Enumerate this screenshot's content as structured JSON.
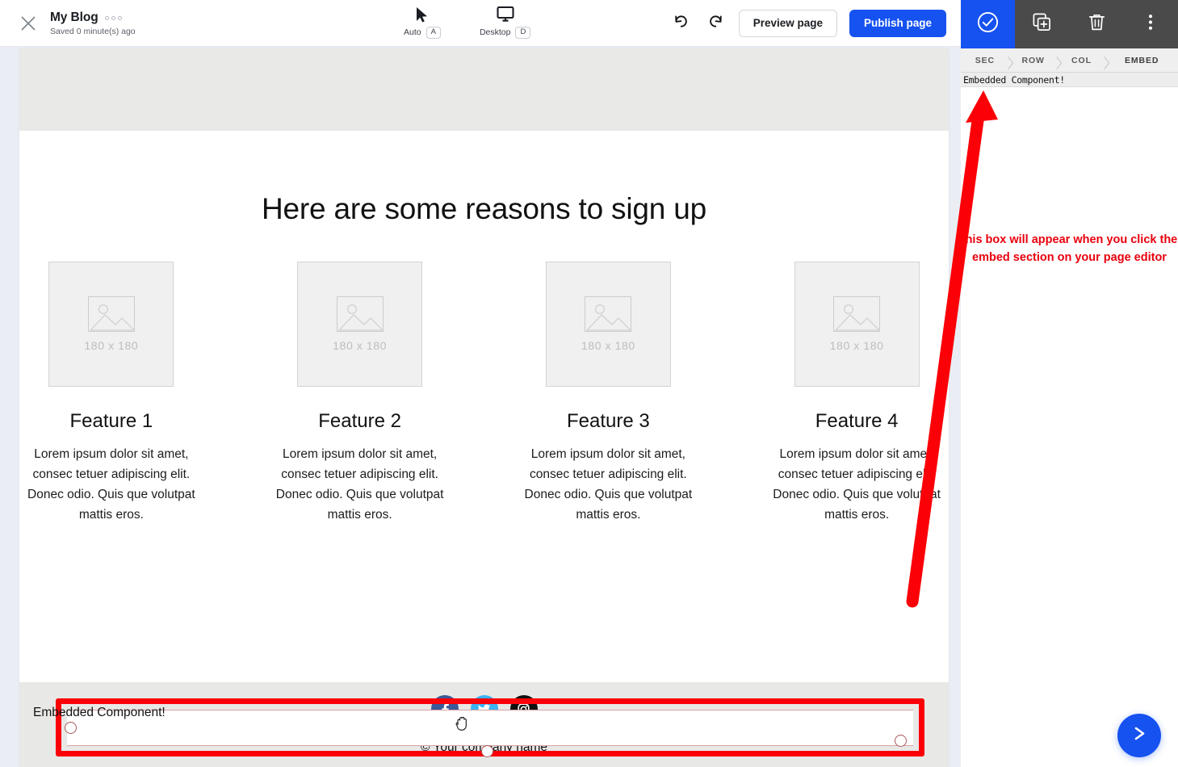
{
  "toolbar": {
    "close_icon": "close-x-icon",
    "page_title": "My Blog",
    "saved_text": "Saved 0 minute(s) ago",
    "more_dots": "three-dots-icon",
    "viewmodes": [
      {
        "icon": "cursor-arrow-icon",
        "label": "Auto",
        "key": "A"
      },
      {
        "icon": "desktop-monitor-icon",
        "label": "Desktop",
        "key": "D"
      }
    ],
    "undo_icon": "undo-arrow-icon",
    "redo_icon": "redo-arrow-icon",
    "preview_label": "Preview page",
    "publish_label": "Publish page",
    "primary_color": "#1652f0"
  },
  "page": {
    "hero_title": "Here are some reasons to sign up",
    "features": [
      {
        "placeholder": "180 x 180",
        "title": "Feature 1",
        "body": "Lorem ipsum dolor sit amet, consec tetuer adipiscing elit. Donec odio. Quis que volutpat mattis eros."
      },
      {
        "placeholder": "180 x 180",
        "title": "Feature 2",
        "body": "Lorem ipsum dolor sit amet, consec tetuer adipiscing elit. Donec odio. Quis que volutpat mattis eros."
      },
      {
        "placeholder": "180 x 180",
        "title": "Feature 3",
        "body": "Lorem ipsum dolor sit amet, consec tetuer adipiscing elit. Donec odio. Quis que volutpat mattis eros."
      },
      {
        "placeholder": "180 x 180",
        "title": "Feature 4",
        "body": "Lorem ipsum dolor sit amet, consec tetuer adipiscing elit. Donec odio. Quis que volutpat mattis eros."
      }
    ],
    "embed": {
      "label": "Embedded Component!",
      "selection_color": "#fb0007",
      "cursor": "grab-hand-cursor"
    },
    "footer": {
      "socials": [
        {
          "name": "facebook-icon",
          "color": "#3b5998"
        },
        {
          "name": "twitter-icon",
          "color": "#3ab3f2"
        },
        {
          "name": "instagram-icon",
          "color": "#111111"
        }
      ],
      "copyright": "© Your company name"
    }
  },
  "right_panel": {
    "icons": [
      {
        "name": "check-circle-icon",
        "active": true
      },
      {
        "name": "duplicate-plus-icon",
        "active": false
      },
      {
        "name": "trash-delete-icon",
        "active": false
      },
      {
        "name": "kebab-more-icon",
        "active": false
      }
    ],
    "breadcrumb": [
      "SEC",
      "ROW",
      "COL",
      "EMBED"
    ],
    "content_text": "Embedded Component!"
  },
  "annotation": {
    "text": "this box will appear when you click the embed section on your page editor",
    "color": "#e8000d",
    "arrow": "red-up-arrow"
  },
  "fab": {
    "icon": "chevron-right-icon",
    "color": "#1652f0"
  }
}
